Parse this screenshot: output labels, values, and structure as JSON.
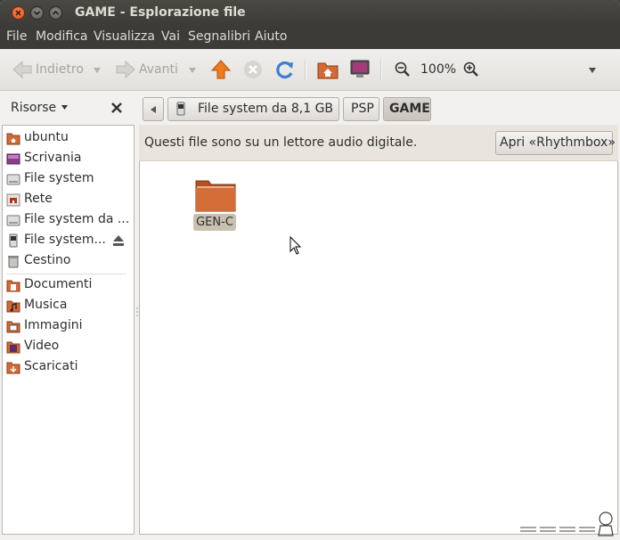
{
  "window": {
    "title": "GAME - Esplorazione file"
  },
  "menubar": {
    "items": [
      "File",
      "Modifica",
      "Visualizza",
      "Vai",
      "Segnalibri",
      "Aiuto"
    ]
  },
  "toolbar": {
    "back_label": "Indietro",
    "forward_label": "Avanti",
    "zoom_level": "100%",
    "icons": [
      "back-arrow-icon",
      "forward-arrow-icon",
      "up-arrow-icon",
      "stop-icon",
      "reload-icon",
      "home-folder-icon",
      "computer-icon",
      "zoom-out-icon",
      "zoom-in-icon",
      "overflow-chevron-icon"
    ]
  },
  "sidebar": {
    "header_label": "Risorse",
    "places": [
      {
        "label": "ubuntu",
        "icon": "home-folder-icon"
      },
      {
        "label": "Scrivania",
        "icon": "desktop-icon"
      },
      {
        "label": "File system",
        "icon": "drive-icon"
      },
      {
        "label": "Rete",
        "icon": "network-icon"
      },
      {
        "label": "File system da ...",
        "icon": "drive-icon"
      },
      {
        "label": "File system...",
        "icon": "media-player-icon"
      },
      {
        "label": "Cestino",
        "icon": "trash-icon"
      }
    ],
    "bookmarks": [
      {
        "label": "Documenti",
        "icon": "documents-folder-icon"
      },
      {
        "label": "Musica",
        "icon": "music-folder-icon"
      },
      {
        "label": "Immagini",
        "icon": "pictures-folder-icon"
      },
      {
        "label": "Video",
        "icon": "video-folder-icon"
      },
      {
        "label": "Scaricati",
        "icon": "downloads-folder-icon"
      }
    ]
  },
  "pathbar": {
    "segments": [
      "File system da 8,1 GB",
      "PSP",
      "GAME"
    ],
    "active_segment": "GAME"
  },
  "infobar": {
    "message": "Questi file sono su un lettore audio digitale.",
    "button_label": "Apri «Rhythmbox»"
  },
  "main": {
    "items": [
      {
        "label": "GEN-C",
        "icon": "folder-icon"
      }
    ]
  },
  "colors": {
    "header": "#3c3b37",
    "accent": "#dd4814",
    "folder": "#c65e2e"
  }
}
